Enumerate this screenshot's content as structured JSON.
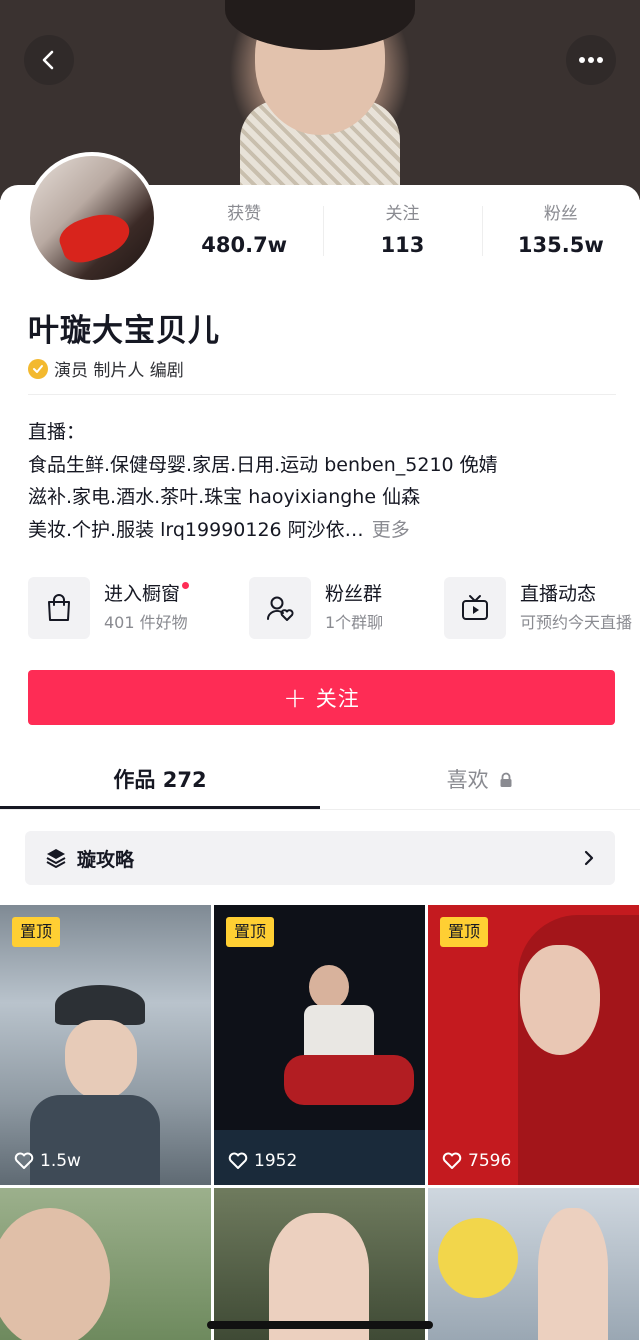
{
  "header": {
    "back_icon": "chevron-left-icon",
    "more_icon": "more-dots-icon"
  },
  "profile": {
    "name": "叶璇大宝贝儿",
    "tags": "演员 制片人 编剧",
    "verify_color": "#f3b92f",
    "stats": [
      {
        "label": "获赞",
        "value": "480.7w"
      },
      {
        "label": "关注",
        "value": "113"
      },
      {
        "label": "粉丝",
        "value": "135.5w"
      }
    ]
  },
  "bio": {
    "lines": [
      "直播：",
      "食品生鲜.保健母婴.家居.日用.运动 benben_5210  俛婧",
      "滋补.家电.酒水.茶叶.珠宝 haoyixianghe  仙森",
      "美妆.个护.服装 lrq19990126  阿沙依…"
    ],
    "more": "更多"
  },
  "entries": [
    {
      "title": "进入橱窗",
      "sub": "401 件好物",
      "icon": "shopping-bag-icon"
    },
    {
      "title": "粉丝群",
      "sub": "1个群聊",
      "icon": "fan-group-icon"
    },
    {
      "title": "直播动态",
      "sub": "可预约今天直播",
      "icon": "live-tv-icon"
    }
  ],
  "follow": {
    "label": "关注",
    "color": "#fe2c55"
  },
  "tabs": [
    {
      "label": "作品 272"
    },
    {
      "label": "喜欢"
    }
  ],
  "collection": {
    "label": "璇攻略"
  },
  "grid": [
    {
      "pinned": "置顶",
      "likes": "1.5w"
    },
    {
      "pinned": "置顶",
      "likes": "1952"
    },
    {
      "pinned": "置顶",
      "likes": "7596"
    },
    {},
    {},
    {}
  ]
}
